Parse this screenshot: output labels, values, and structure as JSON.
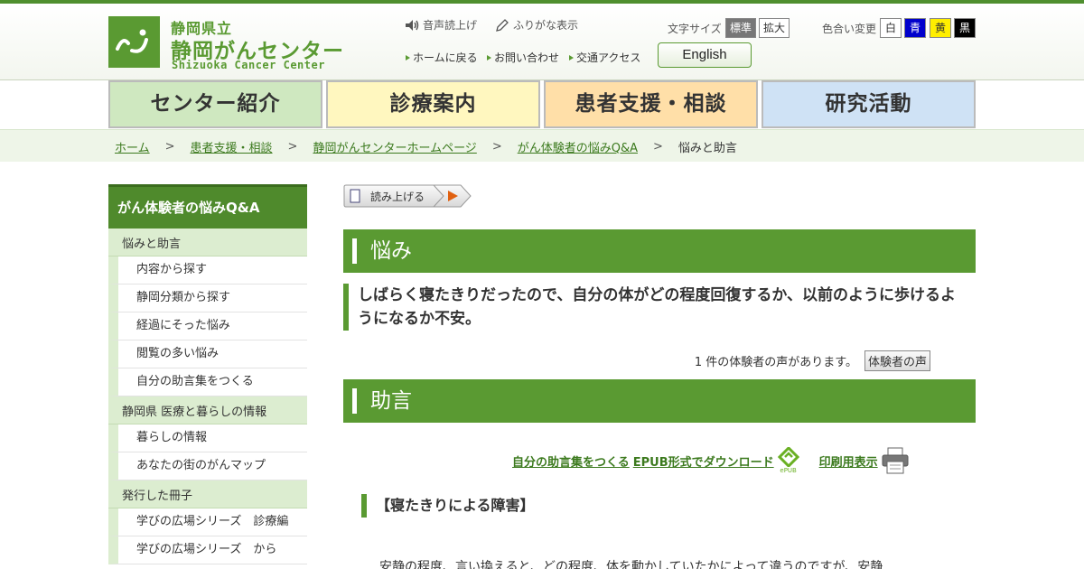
{
  "header": {
    "logo_line1": "静岡県立",
    "logo_line2": "静岡がんセンター",
    "logo_line3": "Shizuoka Cancer Center",
    "voice_read": "音声読上げ",
    "furigana": "ふりがな表示",
    "home_link": "ホームに戻る",
    "contact_link": "お問い合わせ",
    "access_link": "交通アクセス",
    "english_button": "English",
    "font_size_label": "文字サイズ",
    "font_standard": "標準",
    "font_large": "拡大",
    "color_label": "色合い変更",
    "color_white": "白",
    "color_blue": "青",
    "color_yellow": "黄",
    "color_black": "黒"
  },
  "nav": [
    {
      "label": "センター紹介",
      "color": "#cfe8c0"
    },
    {
      "label": "診療案内",
      "color": "#fff7bf"
    },
    {
      "label": "患者支援・相談",
      "color": "#ffdfa8"
    },
    {
      "label": "研究活動",
      "color": "#cfe2f5"
    }
  ],
  "breadcrumbs": [
    "ホーム",
    "患者支援・相談",
    "静岡がんセンターホームページ",
    "がん体験者の悩みQ&A",
    "悩みと助言"
  ],
  "crumb_sep": ">",
  "sidebar": {
    "title": "がん体験者の悩みQ&A",
    "sec1": "悩みと助言",
    "sec1_items": [
      "内容から探す",
      "静岡分類から探す",
      "経過にそった悩み",
      "閲覧の多い悩み",
      "自分の助言集をつくる"
    ],
    "sec2": "静岡県 医療と暮らしの情報",
    "sec2_items": [
      "暮らしの情報",
      "あなたの街のがんマップ"
    ],
    "sec3": "発行した冊子",
    "sec3_items": [
      "学びの広場シリーズ　診療編",
      "学びの広場シリーズ　から"
    ]
  },
  "main": {
    "read_aloud": "読み上げる",
    "worry_heading": "悩み",
    "question": "しばらく寝たきりだったので、自分の体がどの程度回復するか、以前のように歩けるようになるか不安。",
    "voices_text": "1 件の体験者の声があります。",
    "voices_button": "体験者の声",
    "advice_heading": "助言",
    "make_collection": "自分の助言集をつくる",
    "epub_download": "EPUB形式でダウンロード",
    "epub_label": "ePUB",
    "print_view": "印刷用表示",
    "sub_heading": "【寝たきりによる障害】",
    "body_start": "安静の程度、言い換えると、どの程度、体を動かしていたかによって違うのですが、安静"
  }
}
